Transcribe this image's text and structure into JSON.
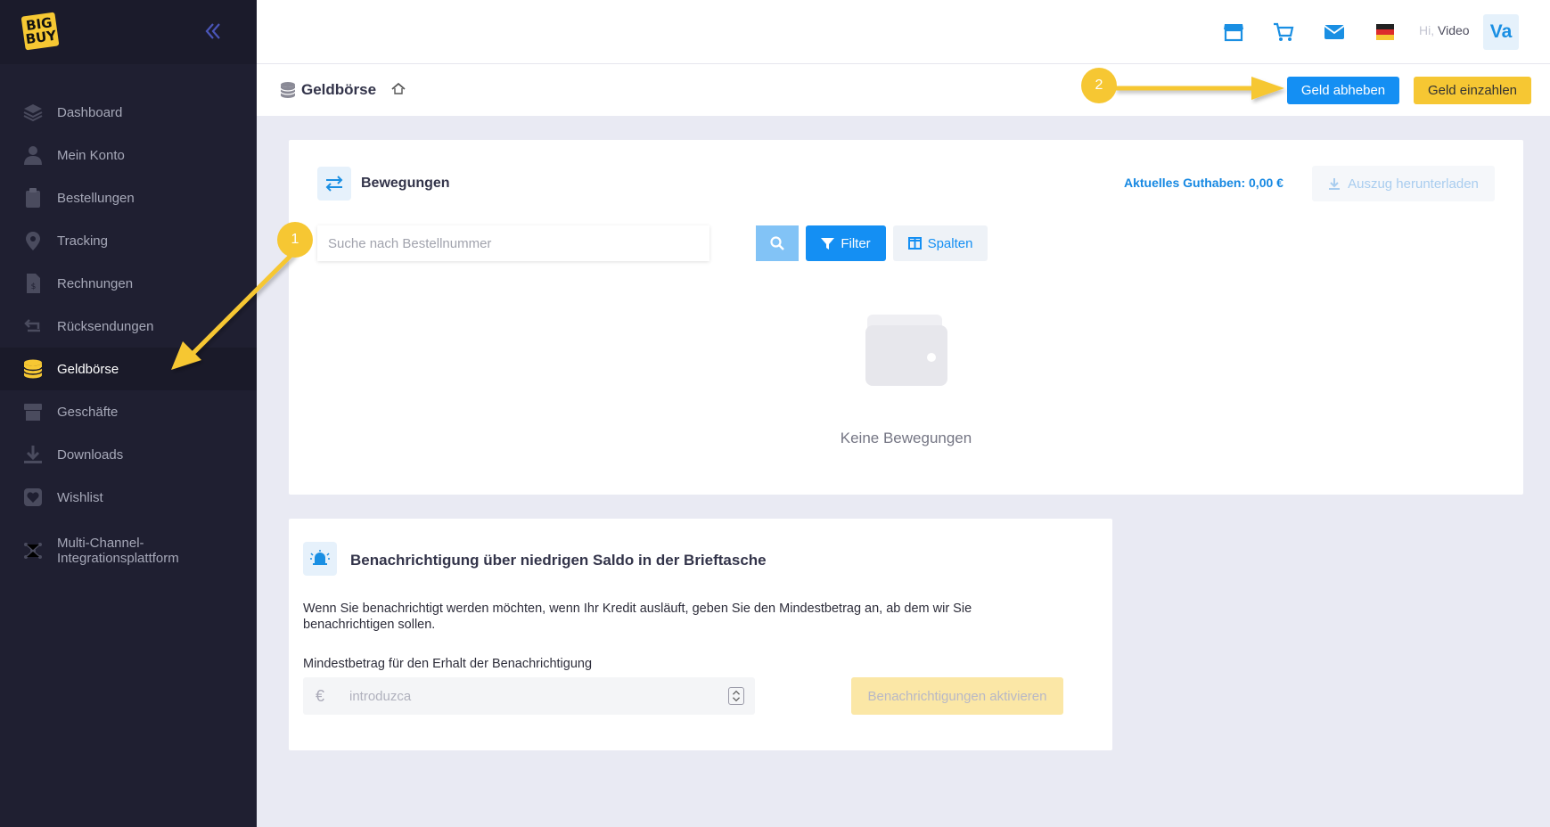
{
  "brand": {
    "logo_line1": "BIG",
    "logo_line2": "BUY"
  },
  "sidebar": {
    "items": [
      {
        "label": "Dashboard",
        "icon": "layers-icon"
      },
      {
        "label": "Mein Konto",
        "icon": "user-icon"
      },
      {
        "label": "Bestellungen",
        "icon": "clipboard-icon"
      },
      {
        "label": "Tracking",
        "icon": "map-pin-icon"
      },
      {
        "label": "Rechnungen",
        "icon": "invoice-icon"
      },
      {
        "label": "Rücksendungen",
        "icon": "return-icon"
      },
      {
        "label": "Geldbörse",
        "icon": "coins-icon",
        "active": true
      },
      {
        "label": "Geschäfte",
        "icon": "store-icon"
      },
      {
        "label": "Downloads",
        "icon": "download-icon"
      },
      {
        "label": "Wishlist",
        "icon": "heart-icon"
      },
      {
        "label": "Multi-Channel-Integrationsplattform",
        "label_line1": "Multi-Channel-",
        "label_line2": "Integrationsplattform",
        "icon": "network-icon"
      }
    ]
  },
  "header": {
    "greeting_prefix": "Hi,",
    "user_name": "Video",
    "avatar_initials": "Va"
  },
  "subheader": {
    "title": "Geldbörse",
    "withdraw_label": "Geld abheben",
    "deposit_label": "Geld einzahlen"
  },
  "movements": {
    "title": "Bewegungen",
    "balance_label": "Aktuelles Guthaben: 0,00 €",
    "download_label": "Auszug herunterladen",
    "search_placeholder": "Suche nach Bestellnummer",
    "filter_label": "Filter",
    "columns_label": "Spalten",
    "empty_text": "Keine Bewegungen"
  },
  "notification": {
    "title": "Benachrichtigung über niedrigen Saldo in der Brieftasche",
    "description": "Wenn Sie benachrichtigt werden möchten, wenn Ihr Kredit ausläuft, geben Sie den Mindestbetrag an, ab dem wir Sie benachrichtigen sollen.",
    "min_label": "Mindestbetrag für den Erhalt der Benachrichtigung",
    "currency_symbol": "€",
    "amount_placeholder": "introduzca",
    "activate_label": "Benachrichtigungen aktivieren"
  },
  "annotations": {
    "step1": "1",
    "step2": "2"
  },
  "colors": {
    "accent_blue": "#148ff3",
    "accent_yellow": "#f6c733",
    "sidebar_bg": "#1f1f31"
  }
}
